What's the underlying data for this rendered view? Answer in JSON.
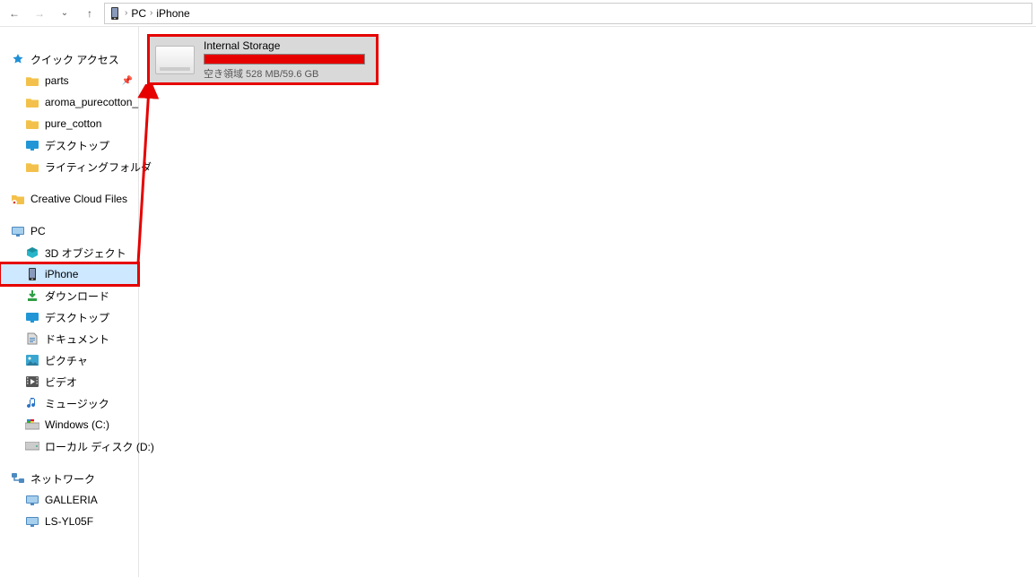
{
  "breadcrumb": {
    "root": "PC",
    "current": "iPhone"
  },
  "sidebar": {
    "quick_access": {
      "label": "クイック アクセス",
      "items": [
        {
          "label": "parts",
          "pinned": true
        },
        {
          "label": "aroma_purecotton_"
        },
        {
          "label": "pure_cotton"
        },
        {
          "label": "デスクトップ"
        },
        {
          "label": "ライティングフォルダ"
        }
      ]
    },
    "creative_cloud": {
      "label": "Creative Cloud Files"
    },
    "pc": {
      "label": "PC",
      "items": [
        {
          "label": "3D オブジェクト"
        },
        {
          "label": "iPhone",
          "selected": true
        },
        {
          "label": "ダウンロード"
        },
        {
          "label": "デスクトップ"
        },
        {
          "label": "ドキュメント"
        },
        {
          "label": "ピクチャ"
        },
        {
          "label": "ビデオ"
        },
        {
          "label": "ミュージック"
        },
        {
          "label": "Windows (C:)"
        },
        {
          "label": "ローカル ディスク (D:)"
        }
      ]
    },
    "network": {
      "label": "ネットワーク",
      "items": [
        {
          "label": "GALLERIA"
        },
        {
          "label": "LS-YL05F"
        }
      ]
    }
  },
  "drive": {
    "title": "Internal Storage",
    "subtitle": "空き領域 528 MB/59.6 GB"
  }
}
